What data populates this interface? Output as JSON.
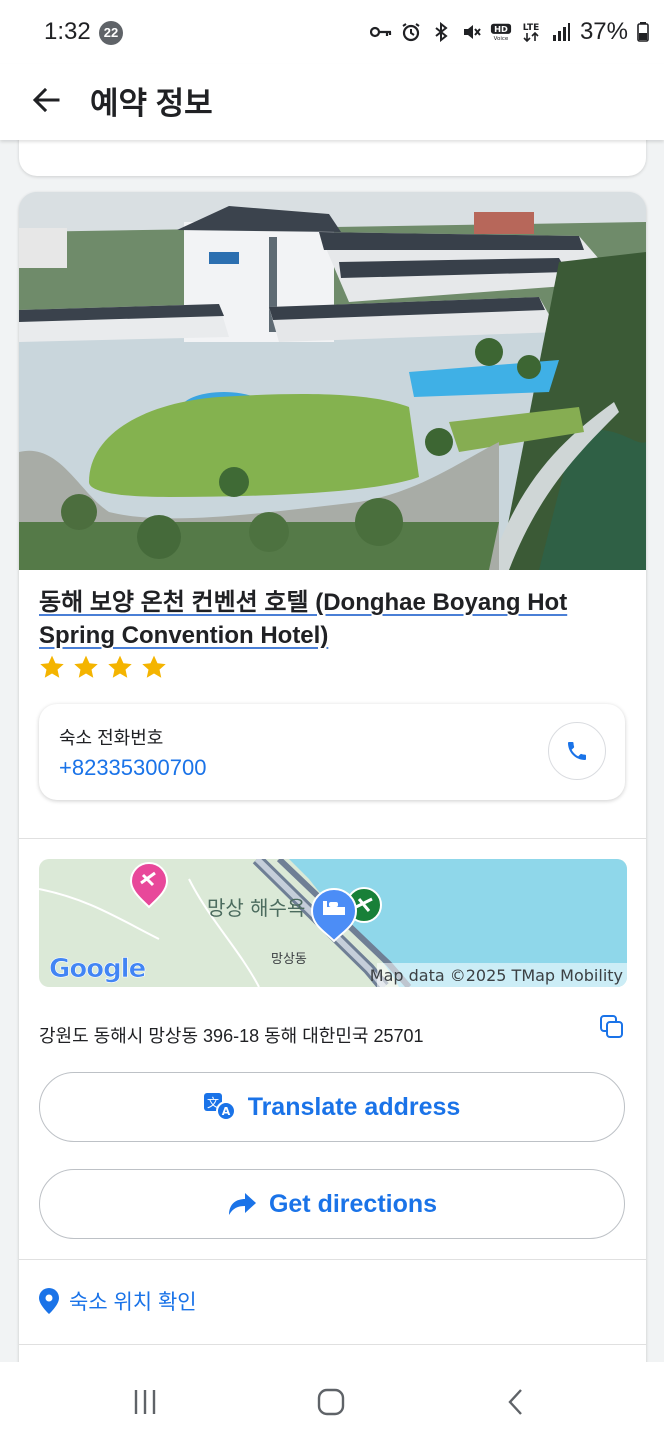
{
  "status_bar": {
    "time": "1:32",
    "notification_count": "22",
    "battery": "37%",
    "icons": [
      "key-icon",
      "alarm-icon",
      "bluetooth-icon",
      "mute-icon",
      "hd-voice-icon",
      "lte-icon",
      "signal-icon",
      "battery-icon"
    ]
  },
  "app_bar": {
    "title": "예약 정보",
    "back_icon": "arrow-back-icon"
  },
  "hotel": {
    "name": "동해 보양 온천 컨벤션 호텔 (Donghae Boyang Hot Spring Convention Hotel)",
    "stars": 4,
    "star_color": "#f4b400",
    "phone_label": "숙소 전화번호",
    "phone_number": "+82335300700"
  },
  "map": {
    "place_label": "망상 해수욕",
    "district_label": "망상동",
    "google_logo": "Google",
    "attribution": "Map data ©2025 TMap Mobility"
  },
  "address": {
    "text": "강원도 동해시 망상동 396-18 동해 대한민국 25701",
    "copy_icon": "copy-icon"
  },
  "actions": {
    "translate_label": "Translate address",
    "directions_label": "Get directions",
    "location_label": "숙소 위치 확인"
  },
  "colors": {
    "accent": "#1a73e8",
    "star": "#f4b400",
    "water": "#8fd7ea",
    "pin_pink": "#e8489a",
    "pin_green": "#188038"
  }
}
